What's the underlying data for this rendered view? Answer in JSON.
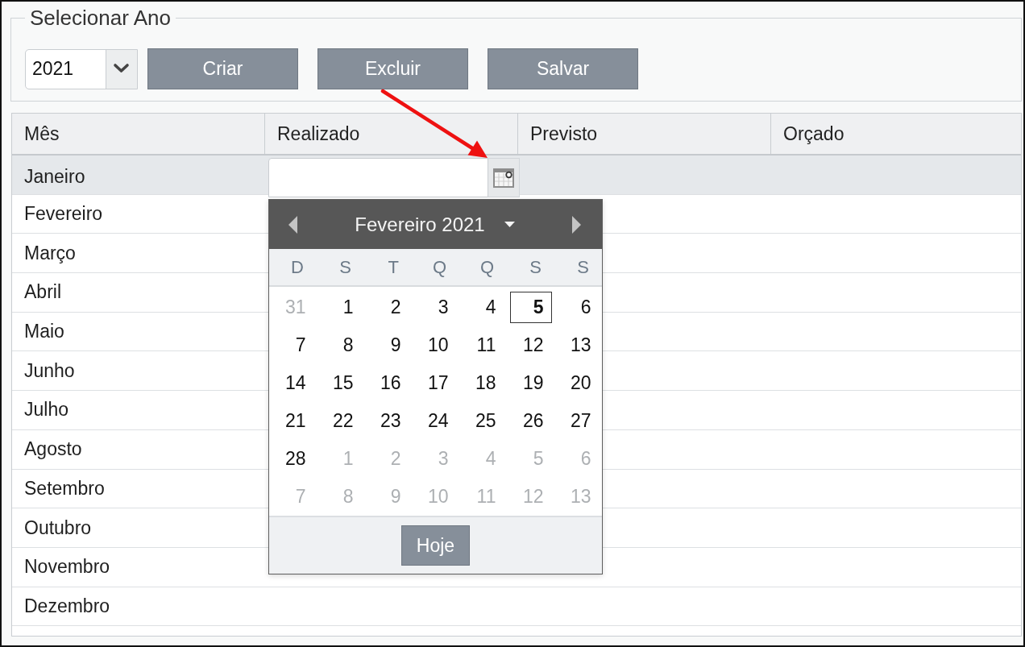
{
  "year_selector": {
    "legend": "Selecionar Ano",
    "value": "2021"
  },
  "buttons": [
    "Criar",
    "Excluir",
    "Salvar"
  ],
  "table": {
    "columns": [
      "Mês",
      "Realizado",
      "Previsto",
      "Orçado"
    ],
    "rows": [
      {
        "month": "Janeiro",
        "selected": true,
        "editing": true
      },
      {
        "month": "Fevereiro",
        "selected": false,
        "editing": false
      },
      {
        "month": "Março",
        "selected": false,
        "editing": false
      },
      {
        "month": "Abril",
        "selected": false,
        "editing": false
      },
      {
        "month": "Maio",
        "selected": false,
        "editing": false
      },
      {
        "month": "Junho",
        "selected": false,
        "editing": false
      },
      {
        "month": "Julho",
        "selected": false,
        "editing": false
      },
      {
        "month": "Agosto",
        "selected": false,
        "editing": false
      },
      {
        "month": "Setembro",
        "selected": false,
        "editing": false
      },
      {
        "month": "Outubro",
        "selected": false,
        "editing": false
      },
      {
        "month": "Novembro",
        "selected": false,
        "editing": false
      },
      {
        "month": "Dezembro",
        "selected": false,
        "editing": false
      }
    ]
  },
  "date_picker": {
    "open": true,
    "title": "Fevereiro 2021",
    "weekdays": [
      "D",
      "S",
      "T",
      "Q",
      "Q",
      "S",
      "S"
    ],
    "weeks": [
      [
        {
          "day": "31",
          "other_month": true,
          "selected": false
        },
        {
          "day": "1",
          "other_month": false,
          "selected": false
        },
        {
          "day": "2",
          "other_month": false,
          "selected": false
        },
        {
          "day": "3",
          "other_month": false,
          "selected": false
        },
        {
          "day": "4",
          "other_month": false,
          "selected": false
        },
        {
          "day": "5",
          "other_month": false,
          "selected": true
        },
        {
          "day": "6",
          "other_month": false,
          "selected": false
        }
      ],
      [
        {
          "day": "7",
          "other_month": false,
          "selected": false
        },
        {
          "day": "8",
          "other_month": false,
          "selected": false
        },
        {
          "day": "9",
          "other_month": false,
          "selected": false
        },
        {
          "day": "10",
          "other_month": false,
          "selected": false
        },
        {
          "day": "11",
          "other_month": false,
          "selected": false
        },
        {
          "day": "12",
          "other_month": false,
          "selected": false
        },
        {
          "day": "13",
          "other_month": false,
          "selected": false
        }
      ],
      [
        {
          "day": "14",
          "other_month": false,
          "selected": false
        },
        {
          "day": "15",
          "other_month": false,
          "selected": false
        },
        {
          "day": "16",
          "other_month": false,
          "selected": false
        },
        {
          "day": "17",
          "other_month": false,
          "selected": false
        },
        {
          "day": "18",
          "other_month": false,
          "selected": false
        },
        {
          "day": "19",
          "other_month": false,
          "selected": false
        },
        {
          "day": "20",
          "other_month": false,
          "selected": false
        }
      ],
      [
        {
          "day": "21",
          "other_month": false,
          "selected": false
        },
        {
          "day": "22",
          "other_month": false,
          "selected": false
        },
        {
          "day": "23",
          "other_month": false,
          "selected": false
        },
        {
          "day": "24",
          "other_month": false,
          "selected": false
        },
        {
          "day": "25",
          "other_month": false,
          "selected": false
        },
        {
          "day": "26",
          "other_month": false,
          "selected": false
        },
        {
          "day": "27",
          "other_month": false,
          "selected": false
        }
      ],
      [
        {
          "day": "28",
          "other_month": false,
          "selected": false
        },
        {
          "day": "1",
          "other_month": true,
          "selected": false
        },
        {
          "day": "2",
          "other_month": true,
          "selected": false
        },
        {
          "day": "3",
          "other_month": true,
          "selected": false
        },
        {
          "day": "4",
          "other_month": true,
          "selected": false
        },
        {
          "day": "5",
          "other_month": true,
          "selected": false
        },
        {
          "day": "6",
          "other_month": true,
          "selected": false
        }
      ],
      [
        {
          "day": "7",
          "other_month": true,
          "selected": false
        },
        {
          "day": "8",
          "other_month": true,
          "selected": false
        },
        {
          "day": "9",
          "other_month": true,
          "selected": false
        },
        {
          "day": "10",
          "other_month": true,
          "selected": false
        },
        {
          "day": "11",
          "other_month": true,
          "selected": false
        },
        {
          "day": "12",
          "other_month": true,
          "selected": false
        },
        {
          "day": "13",
          "other_month": true,
          "selected": false
        }
      ]
    ],
    "today_button": "Hoje"
  },
  "annotations": [
    {
      "kind": "arrow"
    }
  ]
}
